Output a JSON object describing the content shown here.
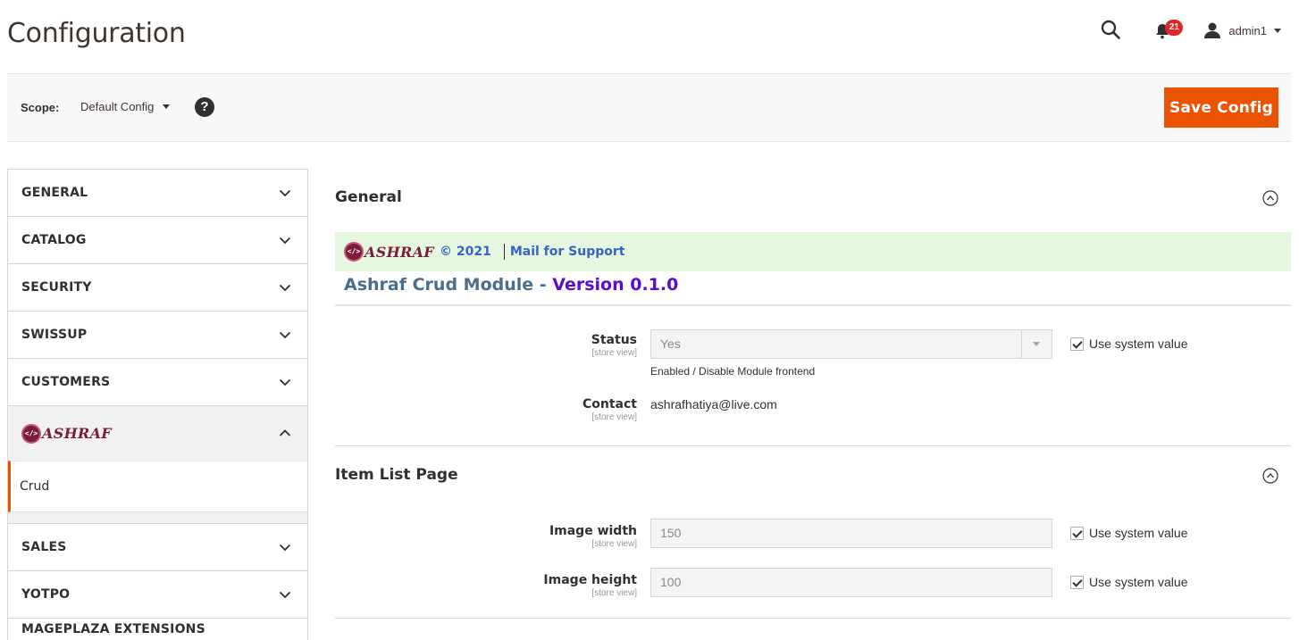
{
  "header": {
    "title": "Configuration",
    "notifications_count": "21",
    "username": "admin1"
  },
  "scope": {
    "label": "Scope:",
    "value": "Default Config",
    "help": "?"
  },
  "save_label": "Save Config",
  "sidebar": {
    "tabs_before": [
      {
        "label": "GENERAL"
      },
      {
        "label": "CATALOG"
      },
      {
        "label": "SECURITY"
      },
      {
        "label": "SWISSUP"
      },
      {
        "label": "CUSTOMERS"
      }
    ],
    "brand_tab": {
      "logo_text": "ASHRAF",
      "logo_glyph": "</>"
    },
    "sub_items": [
      {
        "label": "Crud"
      }
    ],
    "tabs_after": [
      {
        "label": "SALES"
      },
      {
        "label": "YOTPO"
      },
      {
        "label": "MAGEPLAZA EXTENSIONS"
      }
    ]
  },
  "general": {
    "title": "General",
    "banner": {
      "logo_text": "ASHRAF",
      "logo_glyph": "</>",
      "year": "© 2021",
      "mail": "Mail for Support"
    },
    "module_name": "Ashraf Crud Module",
    "dash": "-",
    "version": "Version 0.1.0",
    "status": {
      "label": "Status",
      "scope": "[store view]",
      "value": "Yes",
      "note": "Enabled / Disable Module frontend",
      "use_system": "Use system value"
    },
    "contact": {
      "label": "Contact",
      "scope": "[store view]",
      "value": "ashrafhatiya@live.com"
    }
  },
  "item_list": {
    "title": "Item List Page",
    "image_width": {
      "label": "Image width",
      "scope": "[store view]",
      "value": "150",
      "use_system": "Use system value"
    },
    "image_height": {
      "label": "Image height",
      "scope": "[store view]",
      "value": "100",
      "use_system": "Use system value"
    }
  },
  "colors": {
    "accent": "#eb5202",
    "banner_bg": "#e6f7e0",
    "link": "#3a63c6",
    "version": "#5c0ad8",
    "brand": "#7a1c3c"
  }
}
